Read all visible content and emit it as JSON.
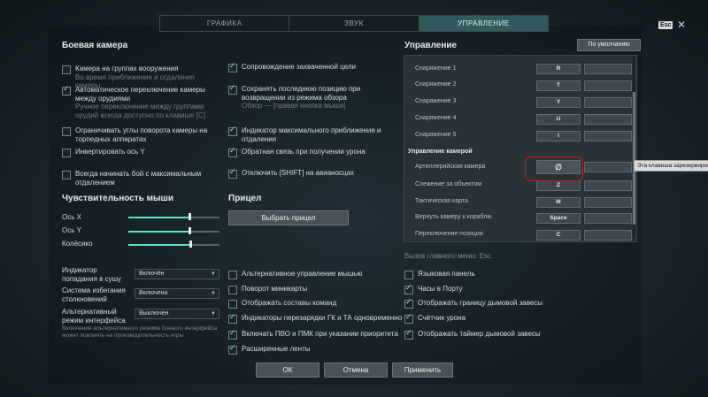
{
  "tabs": [
    "ГРАФИКА",
    "ЗВУК",
    "УПРАВЛЕНИЕ"
  ],
  "esc": "Esc",
  "close": "✕",
  "battle_camera": {
    "title": "Боевая камера",
    "left": [
      {
        "label": "Камера на группах вооружения",
        "sub": "Во время приближения и отдаления камеры",
        "on": false
      },
      {
        "label": "Автоматическое переключение камеры между орудиями",
        "sub": "Ручное переключение между группами орудий всегда доступно по клавише [C]",
        "on": true
      },
      {
        "label": "Ограничивать углы поворота камеры на торпедных аппаратах",
        "sub": "",
        "on": false
      },
      {
        "label": "Инвертировать ось Y",
        "sub": "",
        "on": false
      },
      {
        "label": "Всегда начинать бой с максимальным отдалением",
        "sub": "",
        "on": false
      }
    ],
    "right": [
      {
        "label": "Сопровождение захваченной цели",
        "sub": "",
        "on": true
      },
      {
        "label": "Сохранять последнюю позицию при возвращении из режима обзора",
        "sub": "Обзор — [правая кнопка мыши]",
        "on": true
      },
      {
        "label": "Индикатор максимального приближения и отдаления",
        "sub": "",
        "on": true
      },
      {
        "label": "Обратная связь при получении урона",
        "sub": "",
        "on": true
      },
      {
        "label": "Отключить [SHIFT] на авианосцах",
        "sub": "",
        "on": true
      }
    ]
  },
  "mouse": {
    "title": "Чувствительность мыши",
    "sliders": [
      {
        "label": "Ось X",
        "value": 0.67
      },
      {
        "label": "Ось Y",
        "value": 0.67
      },
      {
        "label": "Колёсико",
        "value": 0.68
      }
    ]
  },
  "sight": {
    "title": "Прицел",
    "button": "Выбрать прицел"
  },
  "controls": {
    "title": "Управление",
    "default_button": "По умолчанию",
    "rows": [
      {
        "label": "Снаряжение 1",
        "key": "R"
      },
      {
        "label": "Снаряжение 2",
        "key": "T"
      },
      {
        "label": "Снаряжение 3",
        "key": "Y"
      },
      {
        "label": "Снаряжение 4",
        "key": "U"
      },
      {
        "label": "Снаряжение 5",
        "key": "I"
      }
    ],
    "section": "Управление камерой",
    "camera_rows": [
      {
        "label": "Артиллерийская камера",
        "key": "∅"
      },
      {
        "label": "Слежение за объектом",
        "key": "Z"
      },
      {
        "label": "Тактическая карта",
        "key": "M"
      },
      {
        "label": "Вернуть камеру к кораблю",
        "key": "Space"
      },
      {
        "label": "Переключение позиции",
        "key": "C"
      }
    ],
    "tooltip": "Эта клавиша зарезервирована",
    "menu_call": "Вызов главного меню: Esc"
  },
  "selects": [
    {
      "label": "Индикатор попадания в сушу",
      "value": "Включён"
    },
    {
      "label": "Система избегания столкновений",
      "value": "Включена"
    },
    {
      "label": "Альтернативный режим интерфейса",
      "value": "Выключен"
    }
  ],
  "alt_note": "Включение альтернативного режима боевого интерфейса может повлиять на производительность игры",
  "mid_options": [
    {
      "label": "Альтернативное управление мышью",
      "on": false
    },
    {
      "label": "Поворот миникарты",
      "on": false
    },
    {
      "label": "Отображать составы команд",
      "on": false
    },
    {
      "label": "Индикаторы перезарядки ГК и ТА одновременно",
      "on": true
    },
    {
      "label": "Включать ПВО и ПМК при указании приоритета",
      "on": true
    },
    {
      "label": "Расширенные ленты",
      "on": true
    }
  ],
  "right_options": [
    {
      "label": "Языковая панель",
      "on": false
    },
    {
      "label": "Часы в Порту",
      "on": true
    },
    {
      "label": "Отображать границу дымовой завесы",
      "on": true
    },
    {
      "label": "Счётчик урона",
      "on": true
    },
    {
      "label": "Отображать таймер дымовой завесы",
      "on": true
    }
  ],
  "footer": {
    "ok": "ОК",
    "cancel": "Отмена",
    "apply": "Применить"
  }
}
